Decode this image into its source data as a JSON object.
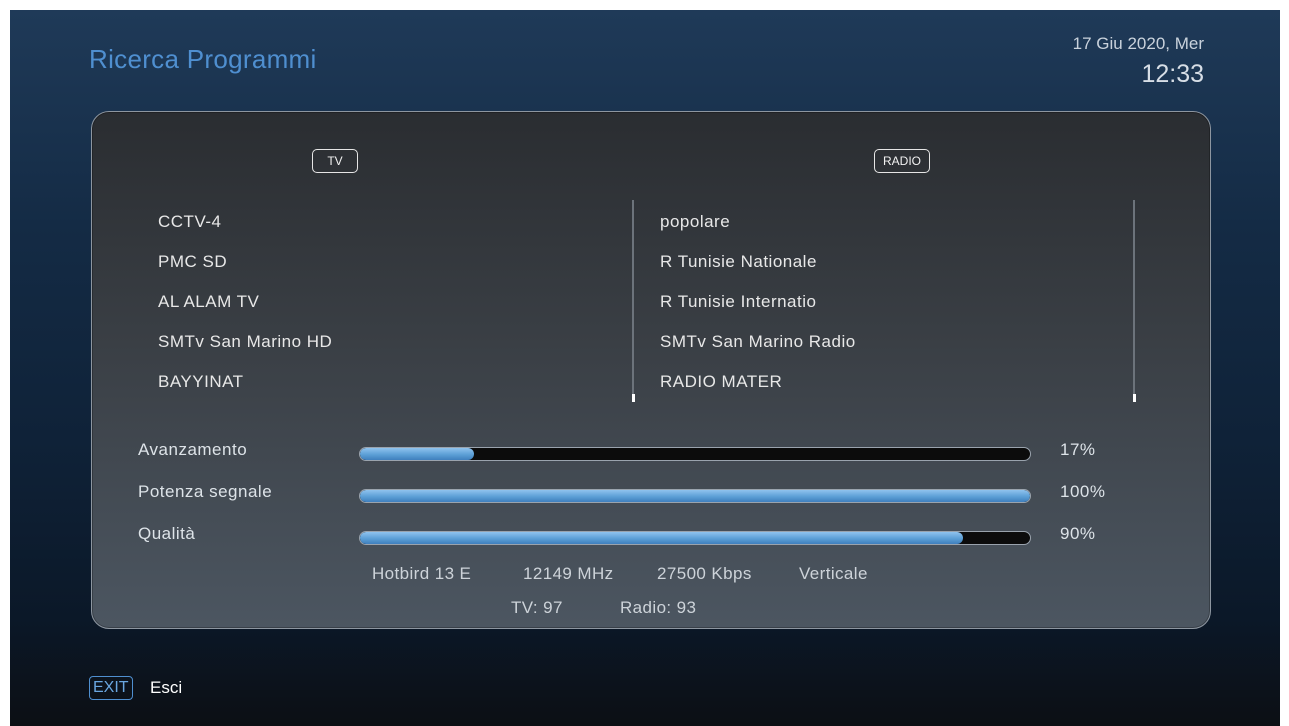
{
  "header": {
    "title": "Ricerca Programmi",
    "date": "17 Giu 2020, Mer",
    "time": "12:33"
  },
  "tv": {
    "badge": "TV",
    "channels": [
      "CCTV-4",
      "PMC SD",
      "AL ALAM TV",
      "SMTv San Marino HD",
      "BAYYINAT"
    ]
  },
  "radio": {
    "badge": "RADIO",
    "channels": [
      "popolare",
      "R Tunisie Nationale",
      "R Tunisie Internatio",
      "SMTv San Marino Radio",
      "RADIO MATER"
    ]
  },
  "bars": [
    {
      "label": "Avanzamento",
      "value": 17,
      "display": "17%"
    },
    {
      "label": "Potenza segnale",
      "value": 100,
      "display": "100%"
    },
    {
      "label": "Qualità",
      "value": 90,
      "display": "90%"
    }
  ],
  "transponder": {
    "satellite": "Hotbird 13 E",
    "frequency": "12149 MHz",
    "symbol_rate": "27500 Kbps",
    "polarization": "Verticale"
  },
  "counts": {
    "tv": "TV: 97",
    "radio": "Radio: 93"
  },
  "footer": {
    "exit_key": "EXIT",
    "exit_label": "Esci"
  },
  "colors": {
    "accent": "#4f8fd0",
    "bar_fill": "#5c9fd6"
  }
}
